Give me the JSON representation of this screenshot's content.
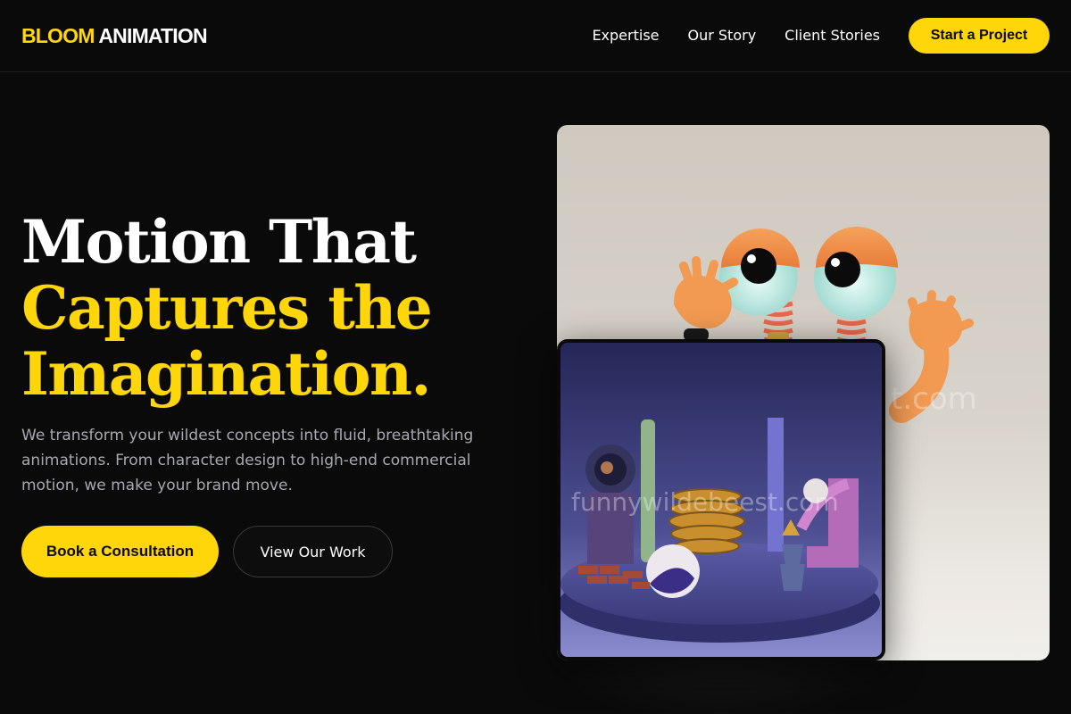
{
  "nav": {
    "logo_brand": "BLOOM",
    "logo_rest": "ANIMATION",
    "links": [
      "Expertise",
      "Our Story",
      "Client Stories"
    ],
    "cta": "Start a Project"
  },
  "hero": {
    "headline_line1": "Motion That",
    "headline_line2": "Captures the",
    "headline_line3": "Imagination.",
    "lead": "We transform your wildest concepts into fluid, breathtaking animations. From character design to high-end commercial motion, we make your brand move.",
    "primary_button": "Book a Consultation",
    "secondary_button": "View Our Work"
  },
  "images": {
    "main_watermark": "t.com",
    "inset_watermark": "funnywildebeest.com"
  },
  "colors": {
    "accent": "#ffd60a",
    "background": "#0a0a0a",
    "muted_text": "#a7a9b0"
  }
}
